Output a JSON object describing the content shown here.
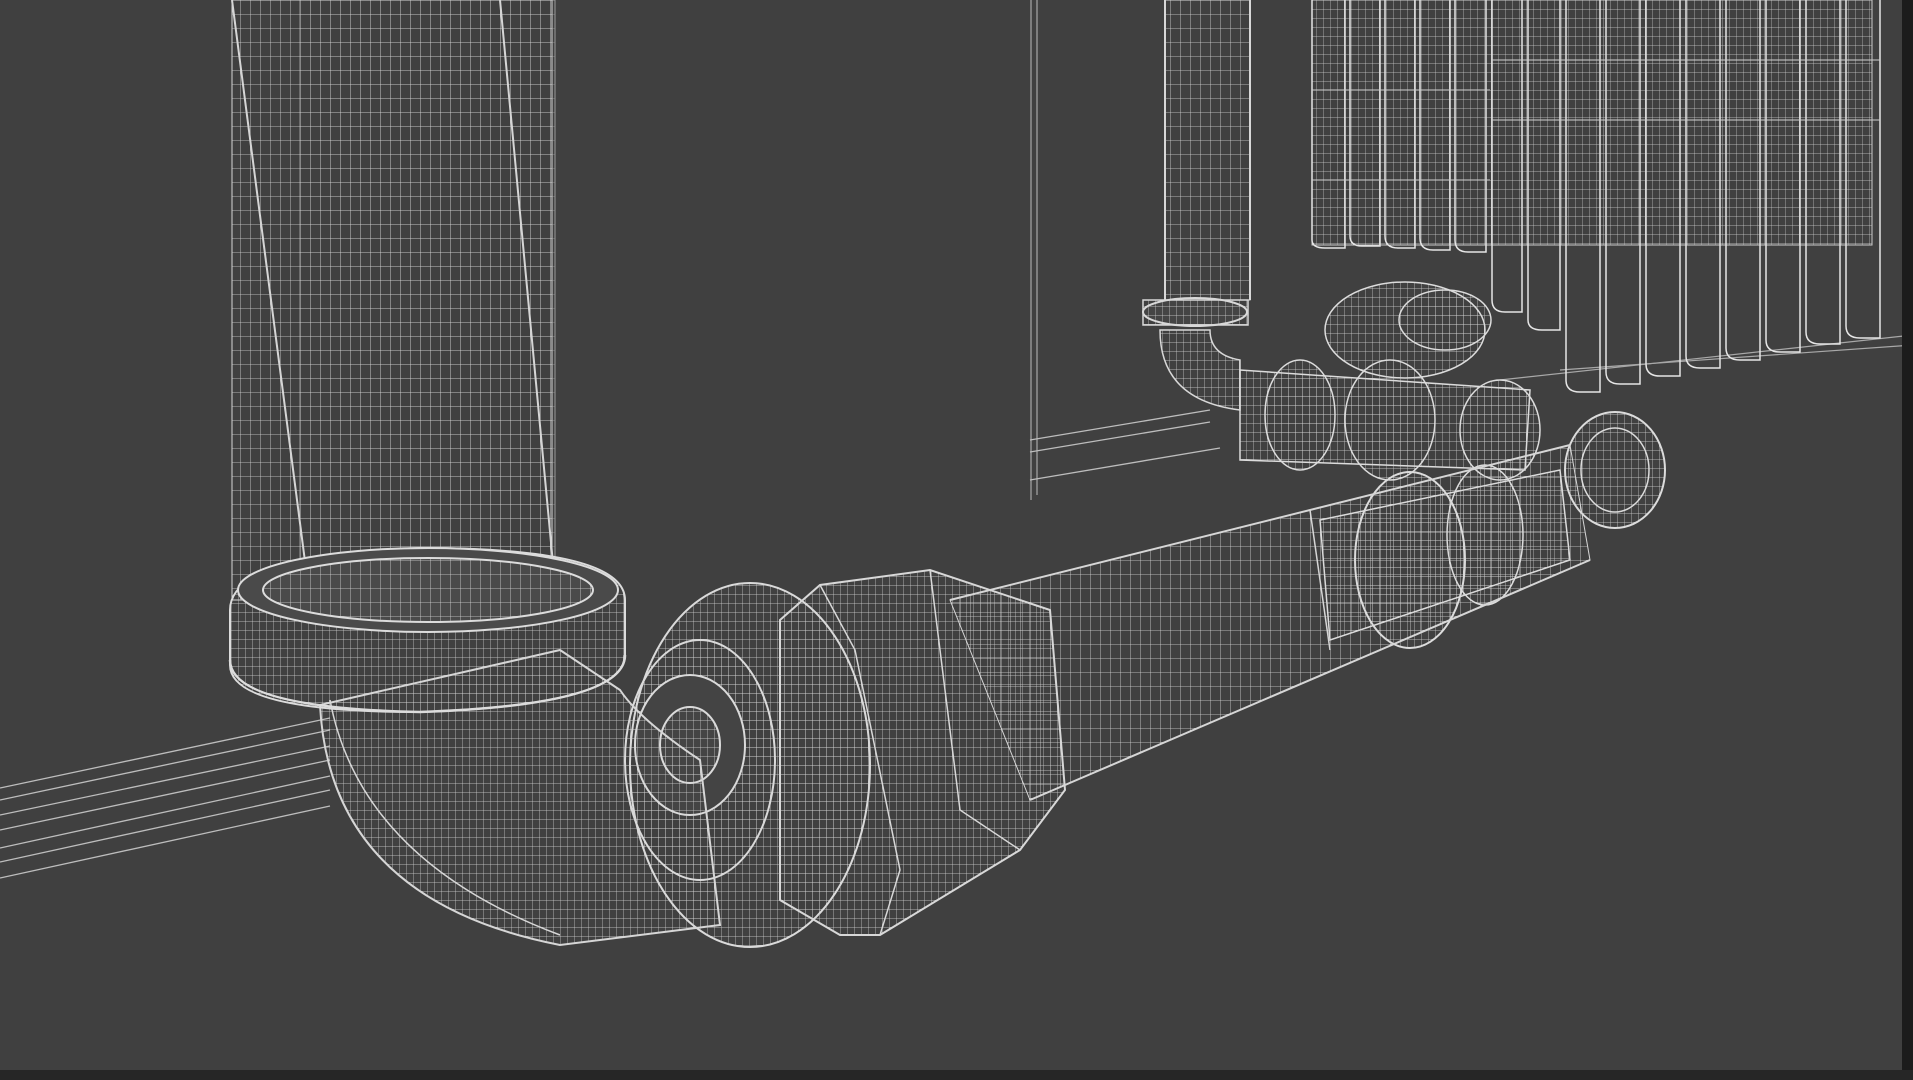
{
  "viewport": {
    "mode": "wireframe",
    "background_color": "#404040",
    "wire_color": "#cfcfcf",
    "wire_dim_color": "#9a9a9a"
  },
  "scene": {
    "objects": [
      "vertical-pipe-left",
      "pipe-collar",
      "elbow-fitting",
      "union-nut",
      "horizontal-pipe",
      "valve-assembly",
      "vertical-pipe-right",
      "radiator",
      "wall-baseboard",
      "wall-corner"
    ]
  }
}
